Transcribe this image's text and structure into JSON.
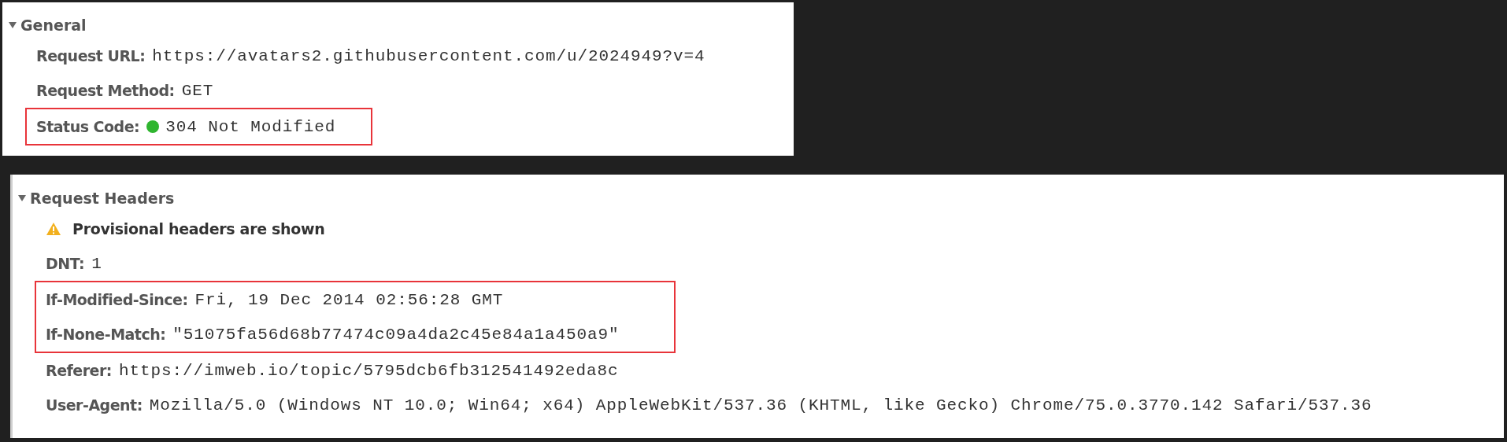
{
  "panels": [
    {
      "title": "General",
      "expanded": true,
      "rows": [
        {
          "kind": "field",
          "name": "Request URL:",
          "value": "https://avatars2.githubusercontent.com/u/2024949?v=4",
          "highlighted": false
        },
        {
          "kind": "field",
          "name": "Request Method:",
          "value": "GET",
          "highlighted": false
        },
        {
          "kind": "status",
          "name": "Status Code:",
          "value": "304 Not Modified",
          "color": "#2fb52f",
          "highlighted": true
        }
      ]
    },
    {
      "title": "Request Headers",
      "expanded": true,
      "rows": [
        {
          "kind": "warning",
          "value": "Provisional headers are shown",
          "highlighted": false
        },
        {
          "kind": "field",
          "name": "DNT:",
          "value": "1",
          "highlighted": false
        },
        {
          "kind": "field",
          "name": "If-Modified-Since:",
          "value": "Fri, 19 Dec 2014 02:56:28 GMT",
          "highlighted": true
        },
        {
          "kind": "field",
          "name": "If-None-Match:",
          "value": "\"51075fa56d68b77474c09a4da2c45e84a1a450a9\"",
          "highlighted": true
        },
        {
          "kind": "field",
          "name": "Referer:",
          "value": "https://imweb.io/topic/5795dcb6fb312541492eda8c",
          "highlighted": false
        },
        {
          "kind": "field",
          "name": "User-Agent:",
          "value": "Mozilla/5.0 (Windows NT 10.0; Win64; x64) AppleWebKit/537.36 (KHTML, like Gecko) Chrome/75.0.3770.142 Safari/537.36",
          "highlighted": false
        }
      ]
    }
  ]
}
